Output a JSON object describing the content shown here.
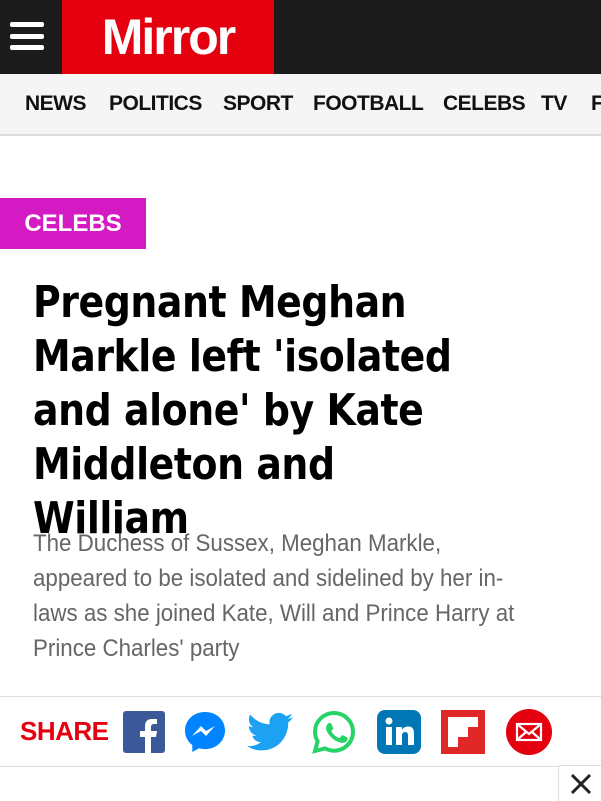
{
  "header": {
    "menu_icon": "hamburger-menu-icon",
    "logo_text": "Mirror",
    "colors": {
      "bar": "#1b1b1b",
      "logo_bg": "#e4000f"
    }
  },
  "nav": {
    "items": [
      "NEWS",
      "POLITICS",
      "SPORT",
      "FOOTBALL",
      "CELEBS",
      "TV",
      "F"
    ]
  },
  "article": {
    "category": "CELEBS",
    "category_color": "#d31ac3",
    "headline": "Pregnant Meghan Markle left 'isolated and alone' by Kate Middleton and William",
    "standfirst": "The Duchess of Sussex, Meghan Markle, appeared to be isolated and sidelined by her in-laws as she joined Kate, Will and Prince Harry at Prince Charles' party"
  },
  "share": {
    "label": "SHARE",
    "icons": [
      "facebook-icon",
      "messenger-icon",
      "twitter-icon",
      "whatsapp-icon",
      "linkedin-icon",
      "flipboard-icon",
      "email-icon"
    ],
    "colors": {
      "facebook": "#3b5998",
      "messenger": "#0084ff",
      "twitter": "#1da1f2",
      "whatsapp": "#25d366",
      "linkedin": "#0077b5",
      "flipboard": "#e12828",
      "email": "#e4000f"
    }
  },
  "overlay": {
    "close_icon": "close-icon"
  }
}
